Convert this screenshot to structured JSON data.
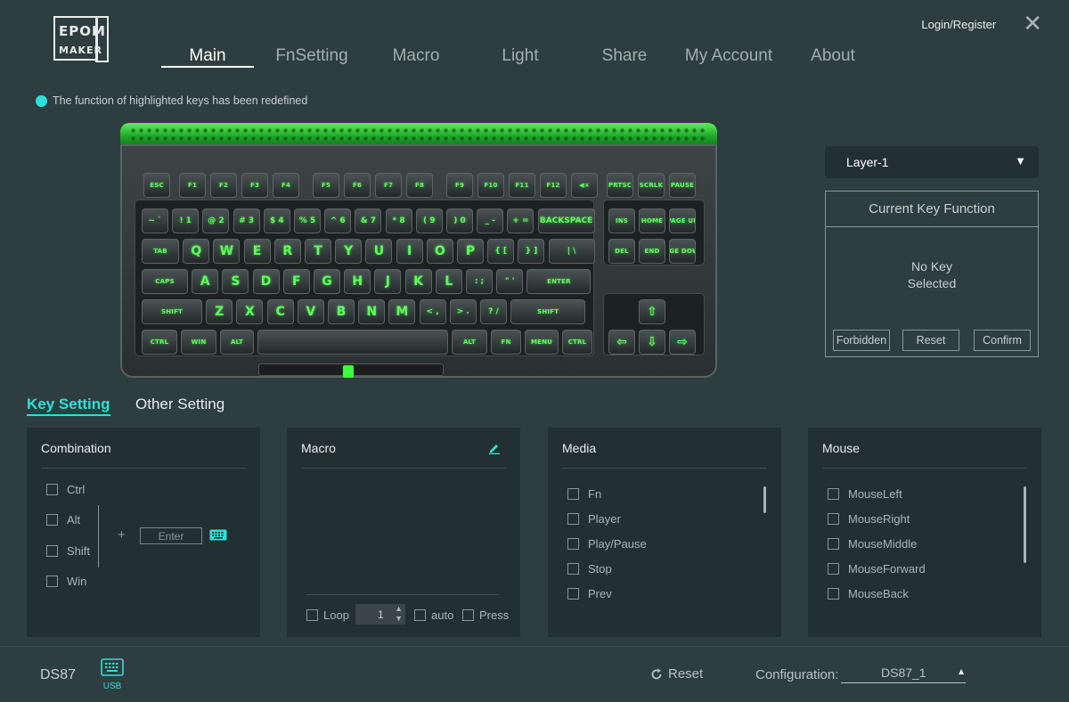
{
  "header": {
    "logo_text": "EPOMAKER",
    "login_label": "Login/Register",
    "close_symbol": "✕"
  },
  "nav": {
    "tabs": [
      {
        "label": "Main",
        "active": true
      },
      {
        "label": "FnSetting",
        "active": false
      },
      {
        "label": "Macro",
        "active": false
      },
      {
        "label": "Light",
        "active": false
      },
      {
        "label": "Share",
        "active": false
      },
      {
        "label": "My Account",
        "active": false
      },
      {
        "label": "About",
        "active": false
      }
    ]
  },
  "notice": {
    "text": "The function of highlighted keys has been redefined",
    "dot_color": "#2de0d8"
  },
  "keyboard": {
    "legend_color": "#5dff5a",
    "rows": {
      "fn_row": [
        "ESC",
        "F1",
        "F2",
        "F3",
        "F4",
        "F5",
        "F6",
        "F7",
        "F8",
        "F9",
        "F10",
        "F11",
        "F12",
        "◀×",
        "PRTSC",
        "SCRLK",
        "PAUSE"
      ],
      "number_row": [
        "~ `",
        "! 1",
        "@ 2",
        "# 3",
        "$ 4",
        "% 5",
        "^ 6",
        "& 7",
        "* 8",
        "( 9",
        ") 0",
        "_ -",
        "+ =",
        "BACKSPACE"
      ],
      "top_row": [
        "TAB",
        "Q",
        "W",
        "E",
        "R",
        "T",
        "Y",
        "U",
        "I",
        "O",
        "P",
        "{ [",
        "} ]",
        "| \\"
      ],
      "home_row": [
        "CAPS",
        "A",
        "S",
        "D",
        "F",
        "G",
        "H",
        "J",
        "K",
        "L",
        ": ;",
        "\" '",
        "ENTER"
      ],
      "bottom_row": [
        "SHIFT",
        "Z",
        "X",
        "C",
        "V",
        "B",
        "N",
        "M",
        "< ,",
        "> .",
        "? /",
        "SHIFT"
      ],
      "space_row": [
        "CTRL",
        "WIN",
        "ALT",
        "",
        "ALT",
        "FN",
        "MENU",
        "CTRL"
      ],
      "nav_cluster": [
        "INS",
        "HOME",
        "PAGE UP",
        "DEL",
        "END",
        "PAGE DOWN"
      ],
      "arrows": [
        "⇧",
        "⇦",
        "⇩",
        "⇨"
      ]
    }
  },
  "layer": {
    "selected": "Layer-1",
    "caret": "▼"
  },
  "current_key_function": {
    "title": "Current Key Function",
    "status": "No Key\nSelected",
    "buttons": [
      "Forbidden",
      "Reset",
      "Confirm"
    ]
  },
  "setting_tabs": [
    {
      "label": "Key Setting",
      "active": true
    },
    {
      "label": "Other Setting",
      "active": false
    }
  ],
  "panels": {
    "combination": {
      "title": "Combination",
      "modifiers": [
        "Ctrl",
        "Alt",
        "Shift",
        "Win"
      ],
      "plus": "+",
      "key_placeholder": "Enter"
    },
    "macro": {
      "title": "Macro",
      "loop_label": "Loop",
      "loop_value": "1",
      "auto_label": "auto",
      "press_label": "Press"
    },
    "media": {
      "title": "Media",
      "items": [
        "Fn",
        "Player",
        "Play/Pause",
        "Stop",
        "Prev"
      ]
    },
    "mouse": {
      "title": "Mouse",
      "items": [
        "MouseLeft",
        "MouseRight",
        "MouseMiddle",
        "MouseForward",
        "MouseBack"
      ]
    }
  },
  "footer": {
    "model": "DS87",
    "connection": "USB",
    "reset_label": "Reset",
    "config_label": "Configuration:",
    "config_value": "DS87_1",
    "config_caret": "▲"
  }
}
